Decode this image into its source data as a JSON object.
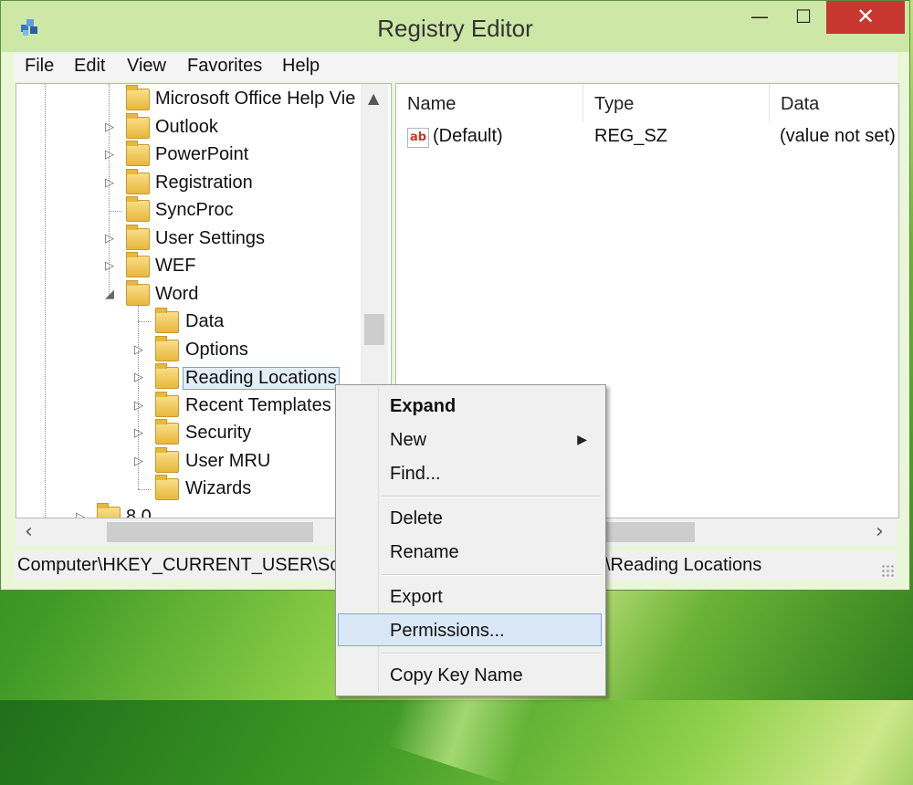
{
  "window": {
    "title": "Registry Editor",
    "controls": {
      "minimize": "—",
      "maximize": "☐",
      "close": "✕"
    }
  },
  "menu": [
    "File",
    "Edit",
    "View",
    "Favorites",
    "Help"
  ],
  "tree": {
    "items": [
      {
        "label": "Microsoft Office Help Vie",
        "expander": ""
      },
      {
        "label": "Outlook",
        "expander": "▷"
      },
      {
        "label": "PowerPoint",
        "expander": "▷"
      },
      {
        "label": "Registration",
        "expander": "▷"
      },
      {
        "label": "SyncProc",
        "expander": ""
      },
      {
        "label": "User Settings",
        "expander": "▷"
      },
      {
        "label": "WEF",
        "expander": "▷"
      },
      {
        "label": "Word",
        "expander": "◢"
      },
      {
        "label": "Data",
        "expander": ""
      },
      {
        "label": "Options",
        "expander": "▷"
      },
      {
        "label": "Reading Locations",
        "expander": "▷"
      },
      {
        "label": "Recent Templates",
        "expander": "▷"
      },
      {
        "label": "Security",
        "expander": "▷"
      },
      {
        "label": "User MRU",
        "expander": "▷"
      },
      {
        "label": "Wizards",
        "expander": ""
      },
      {
        "label": "8.0",
        "expander": "▷"
      }
    ]
  },
  "list": {
    "columns": [
      "Name",
      "Type",
      "Data"
    ],
    "rows": [
      {
        "icon": "ab",
        "name": "(Default)",
        "type": "REG_SZ",
        "data": "(value not set)"
      }
    ]
  },
  "status": {
    "path_start": "Computer\\HKEY_CURRENT_USER\\Softv",
    "path_end": "\\Reading Locations"
  },
  "context_menu": {
    "items": [
      {
        "label": "Expand"
      },
      {
        "label": "New"
      },
      {
        "label": "Find..."
      },
      {
        "label": "Delete"
      },
      {
        "label": "Rename"
      },
      {
        "label": "Export"
      },
      {
        "label": "Permissions..."
      },
      {
        "label": "Copy Key Name"
      }
    ],
    "submenu_arrow": "▶"
  },
  "icons": {
    "app": "registry-editor-icon",
    "folder": "folder-icon",
    "value": "string-value-icon",
    "scroll_up": "▲",
    "scroll_left": "‹",
    "scroll_right": "›"
  }
}
